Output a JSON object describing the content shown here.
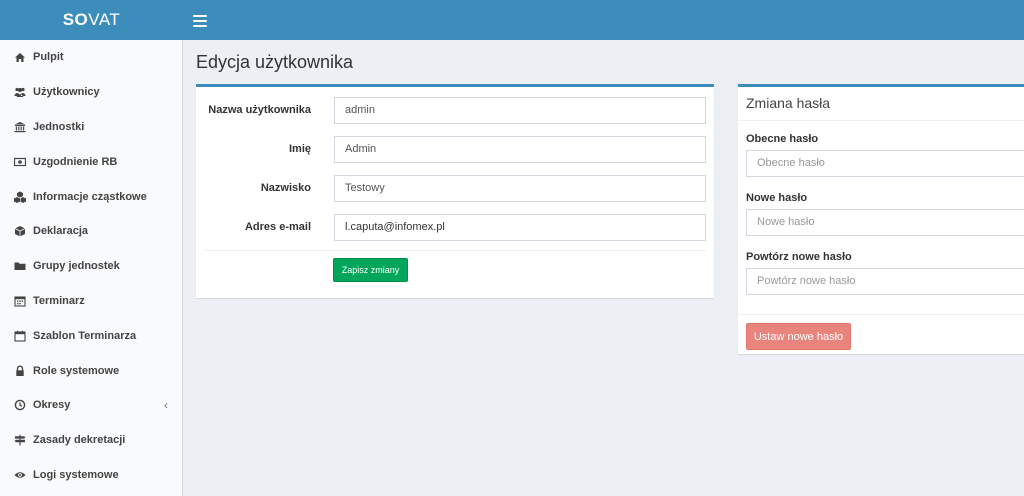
{
  "app": {
    "logo_bold": "SO",
    "logo_rest": "VAT"
  },
  "sidebar": {
    "items": [
      {
        "label": "Pulpit",
        "icon": "home-icon"
      },
      {
        "label": "Użytkownicy",
        "icon": "users-icon"
      },
      {
        "label": "Jednostki",
        "icon": "institution-icon"
      },
      {
        "label": "Uzgodnienie RB",
        "icon": "money-icon"
      },
      {
        "label": "Informacje cząstkowe",
        "icon": "cubes-icon"
      },
      {
        "label": "Deklaracja",
        "icon": "cube-icon"
      },
      {
        "label": "Grupy jednostek",
        "icon": "folder-icon"
      },
      {
        "label": "Terminarz",
        "icon": "calendar-icon"
      },
      {
        "label": "Szablon Terminarza",
        "icon": "calendar-outline-icon"
      },
      {
        "label": "Role systemowe",
        "icon": "lock-icon"
      },
      {
        "label": "Okresy",
        "icon": "clock-icon",
        "chevron": "‹"
      },
      {
        "label": "Zasady dekretacji",
        "icon": "signpost-icon"
      },
      {
        "label": "Logi systemowe",
        "icon": "eye-icon"
      }
    ]
  },
  "main": {
    "title": "Edycja użytkownika",
    "user_form": {
      "username_label": "Nazwa użytkownika",
      "username_value": "admin",
      "firstname_label": "Imię",
      "firstname_value": "Admin",
      "lastname_label": "Nazwisko",
      "lastname_value": "Testowy",
      "email_label": "Adres e-mail",
      "email_value": "l.caputa@infomex.pl",
      "save_label": "Zapisz zmiany"
    },
    "password_form": {
      "title": "Zmiana hasła",
      "current_label": "Obecne hasło",
      "current_placeholder": "Obecne hasło",
      "new_label": "Nowe hasło",
      "new_placeholder": "Nowe hasło",
      "repeat_label": "Powtórz nowe hasło",
      "repeat_placeholder": "Powtórz nowe hasło",
      "submit_label": "Ustaw nowe hasło"
    }
  },
  "colors": {
    "header": "#3c8dbc",
    "success": "#00a65a",
    "danger_disabled": "#e8847c",
    "background": "#ecf0f5"
  }
}
